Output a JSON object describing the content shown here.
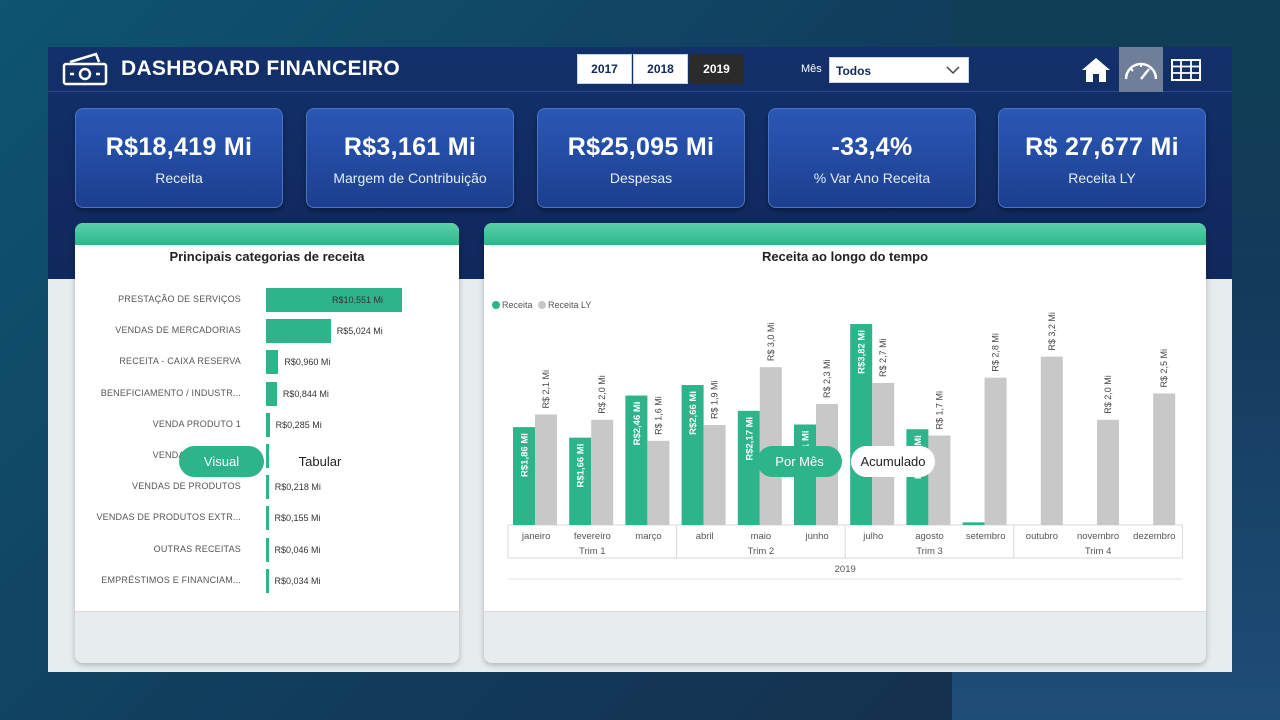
{
  "header": {
    "title": "DASHBOARD FINANCEIRO",
    "years": [
      "2017",
      "2018",
      "2019"
    ],
    "selected_year": "2019",
    "month_label": "Mês",
    "month_value": "Todos",
    "nav": [
      "home-icon",
      "gauge-icon",
      "table-icon"
    ],
    "selected_nav": "gauge-icon"
  },
  "kpis": [
    {
      "value": "R$18,419 Mi",
      "label": "Receita"
    },
    {
      "value": "R$3,161 Mi",
      "label": "Margem de Contribuição"
    },
    {
      "value": "R$25,095 Mi",
      "label": "Despesas"
    },
    {
      "value": "-33,4%",
      "label": "% Var Ano Receita"
    },
    {
      "value": "R$ 27,677 Mi",
      "label": "Receita LY"
    }
  ],
  "left_card": {
    "title": "Principais categorias de receita",
    "toggle": [
      "Visual",
      "Tabular"
    ],
    "selected_toggle": "Visual"
  },
  "right_card": {
    "title": "Receita ao longo do tempo",
    "toggle": [
      "Por Mês",
      "Acumulado"
    ],
    "selected_toggle": "Por Mês"
  },
  "colors": {
    "accent": "#2db489",
    "gray_series": "#c8c8c8",
    "navy": "#12306a"
  },
  "chart_data": [
    {
      "type": "bar",
      "orientation": "horizontal",
      "title": "Principais categorias de receita",
      "categories": [
        "PRESTAÇÃO DE SERVIÇOS",
        "VENDAS DE MERCADORIAS",
        "RECEITA - CAIXA RESERVA",
        "BENEFICIAMENTO / INDUSTR...",
        "VENDA PRODUTO 1",
        "VENDA PRODUTO 2",
        "VENDAS DE PRODUTOS",
        "VENDAS DE PRODUTOS EXTR...",
        "OUTRAS RECEITAS",
        "EMPRÉSTIMOS E FINANCIAM..."
      ],
      "values": [
        10.551,
        5.024,
        0.96,
        0.844,
        0.285,
        0.271,
        0.218,
        0.155,
        0.046,
        0.034
      ],
      "labels": [
        "R$10,551 Mi",
        "R$5,024 Mi",
        "R$0,960 Mi",
        "R$0,844 Mi",
        "R$0,285 Mi",
        "R$0,271 Mi",
        "R$0,218 Mi",
        "R$0,155 Mi",
        "R$0,046 Mi",
        "R$0,034 Mi"
      ]
    },
    {
      "type": "bar",
      "title": "Receita ao longo do tempo",
      "legend": "top-left",
      "categories": [
        "janeiro",
        "fevereiro",
        "março",
        "abril",
        "maio",
        "junho",
        "julho",
        "agosto",
        "setembro",
        "outubro",
        "novembro",
        "dezembro"
      ],
      "quarters": [
        "Trim 1",
        "Trim 2",
        "Trim 3",
        "Trim 4"
      ],
      "year": "2019",
      "series": [
        {
          "name": "Receita",
          "color": "#2db489",
          "values": [
            1.86,
            1.66,
            2.46,
            2.66,
            2.17,
            1.91,
            3.82,
            1.82,
            0.05,
            null,
            null,
            null
          ],
          "labels": [
            "R$1,86 Mi",
            "R$1,66 Mi",
            "R$2,46 Mi",
            "R$2,66 Mi",
            "R$2,17 Mi",
            "R$1,91 Mi",
            "R$3,82 Mi",
            "R$1,82 Mi",
            "",
            "",
            "",
            ""
          ]
        },
        {
          "name": "Receita LY",
          "color": "#c8c8c8",
          "values": [
            2.1,
            2.0,
            1.6,
            1.9,
            3.0,
            2.3,
            2.7,
            1.7,
            2.8,
            3.2,
            2.0,
            2.5
          ],
          "labels": [
            "R$ 2,1 Mi",
            "R$ 2,0 Mi",
            "R$ 1,6 Mi",
            "R$ 1,9 Mi",
            "R$ 3,0 Mi",
            "R$ 2,3 Mi",
            "R$ 2,7 Mi",
            "R$ 1,7 Mi",
            "R$ 2,8 Mi",
            "R$ 3,2 Mi",
            "R$ 2,0 Mi",
            "R$ 2,5 Mi"
          ]
        }
      ]
    }
  ]
}
